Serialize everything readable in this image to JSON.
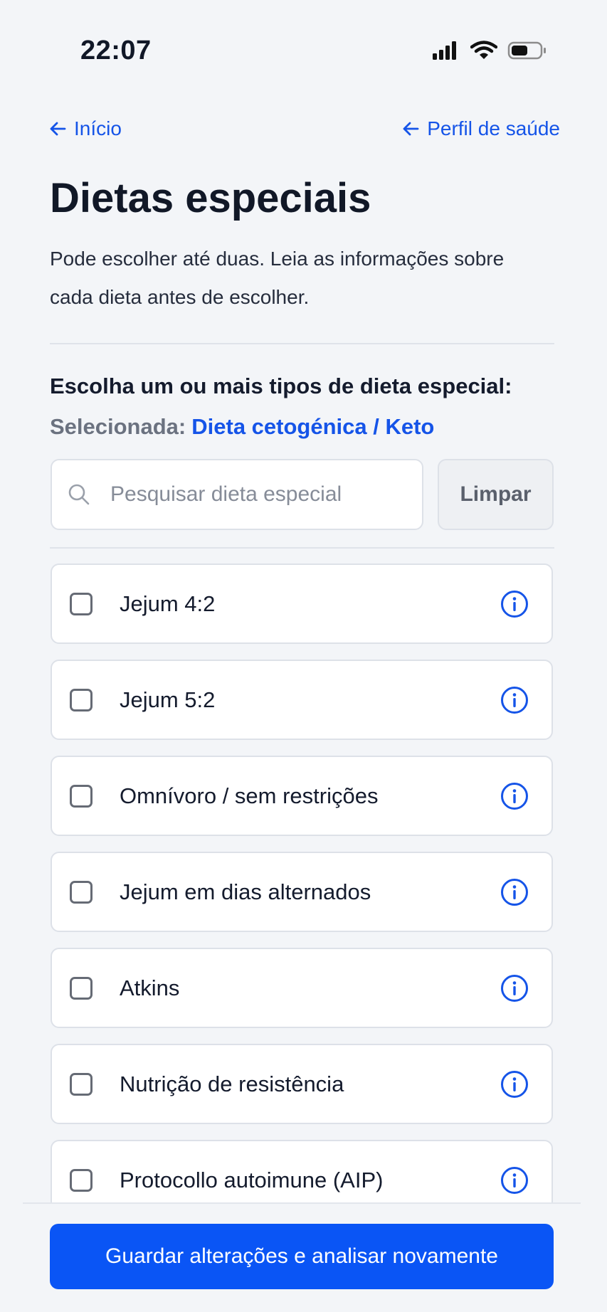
{
  "status_bar": {
    "time": "22:07"
  },
  "nav": {
    "back_label": "Início",
    "profile_label": "Perfil de saúde"
  },
  "page": {
    "title": "Dietas especiais",
    "intro_line1": "Pode escolher até duas. Leia as informações sobre",
    "intro_line2": "cada dieta antes de escolher."
  },
  "selection": {
    "heading": "Escolha um ou mais tipos de dieta especial:",
    "selected_prefix": "Selecionada:",
    "selected_value": "Dieta cetogénica / Keto"
  },
  "search": {
    "placeholder": "Pesquisar dieta especial",
    "clear_label": "Limpar"
  },
  "diets": [
    {
      "label": "Jejum 4:2",
      "checked": false
    },
    {
      "label": "Jejum 5:2",
      "checked": false
    },
    {
      "label": "Omnívoro / sem restrições",
      "checked": false
    },
    {
      "label": "Jejum em dias alternados",
      "checked": false
    },
    {
      "label": "Atkins",
      "checked": false
    },
    {
      "label": "Nutrição de resistência",
      "checked": false
    },
    {
      "label": "Protocollo autoimune (AIP)",
      "checked": false
    }
  ],
  "footer": {
    "save_label": "Guardar alterações e analisar novamente"
  },
  "colors": {
    "accent": "#1554e8",
    "button": "#0a55f5",
    "background": "#f3f5f8"
  }
}
